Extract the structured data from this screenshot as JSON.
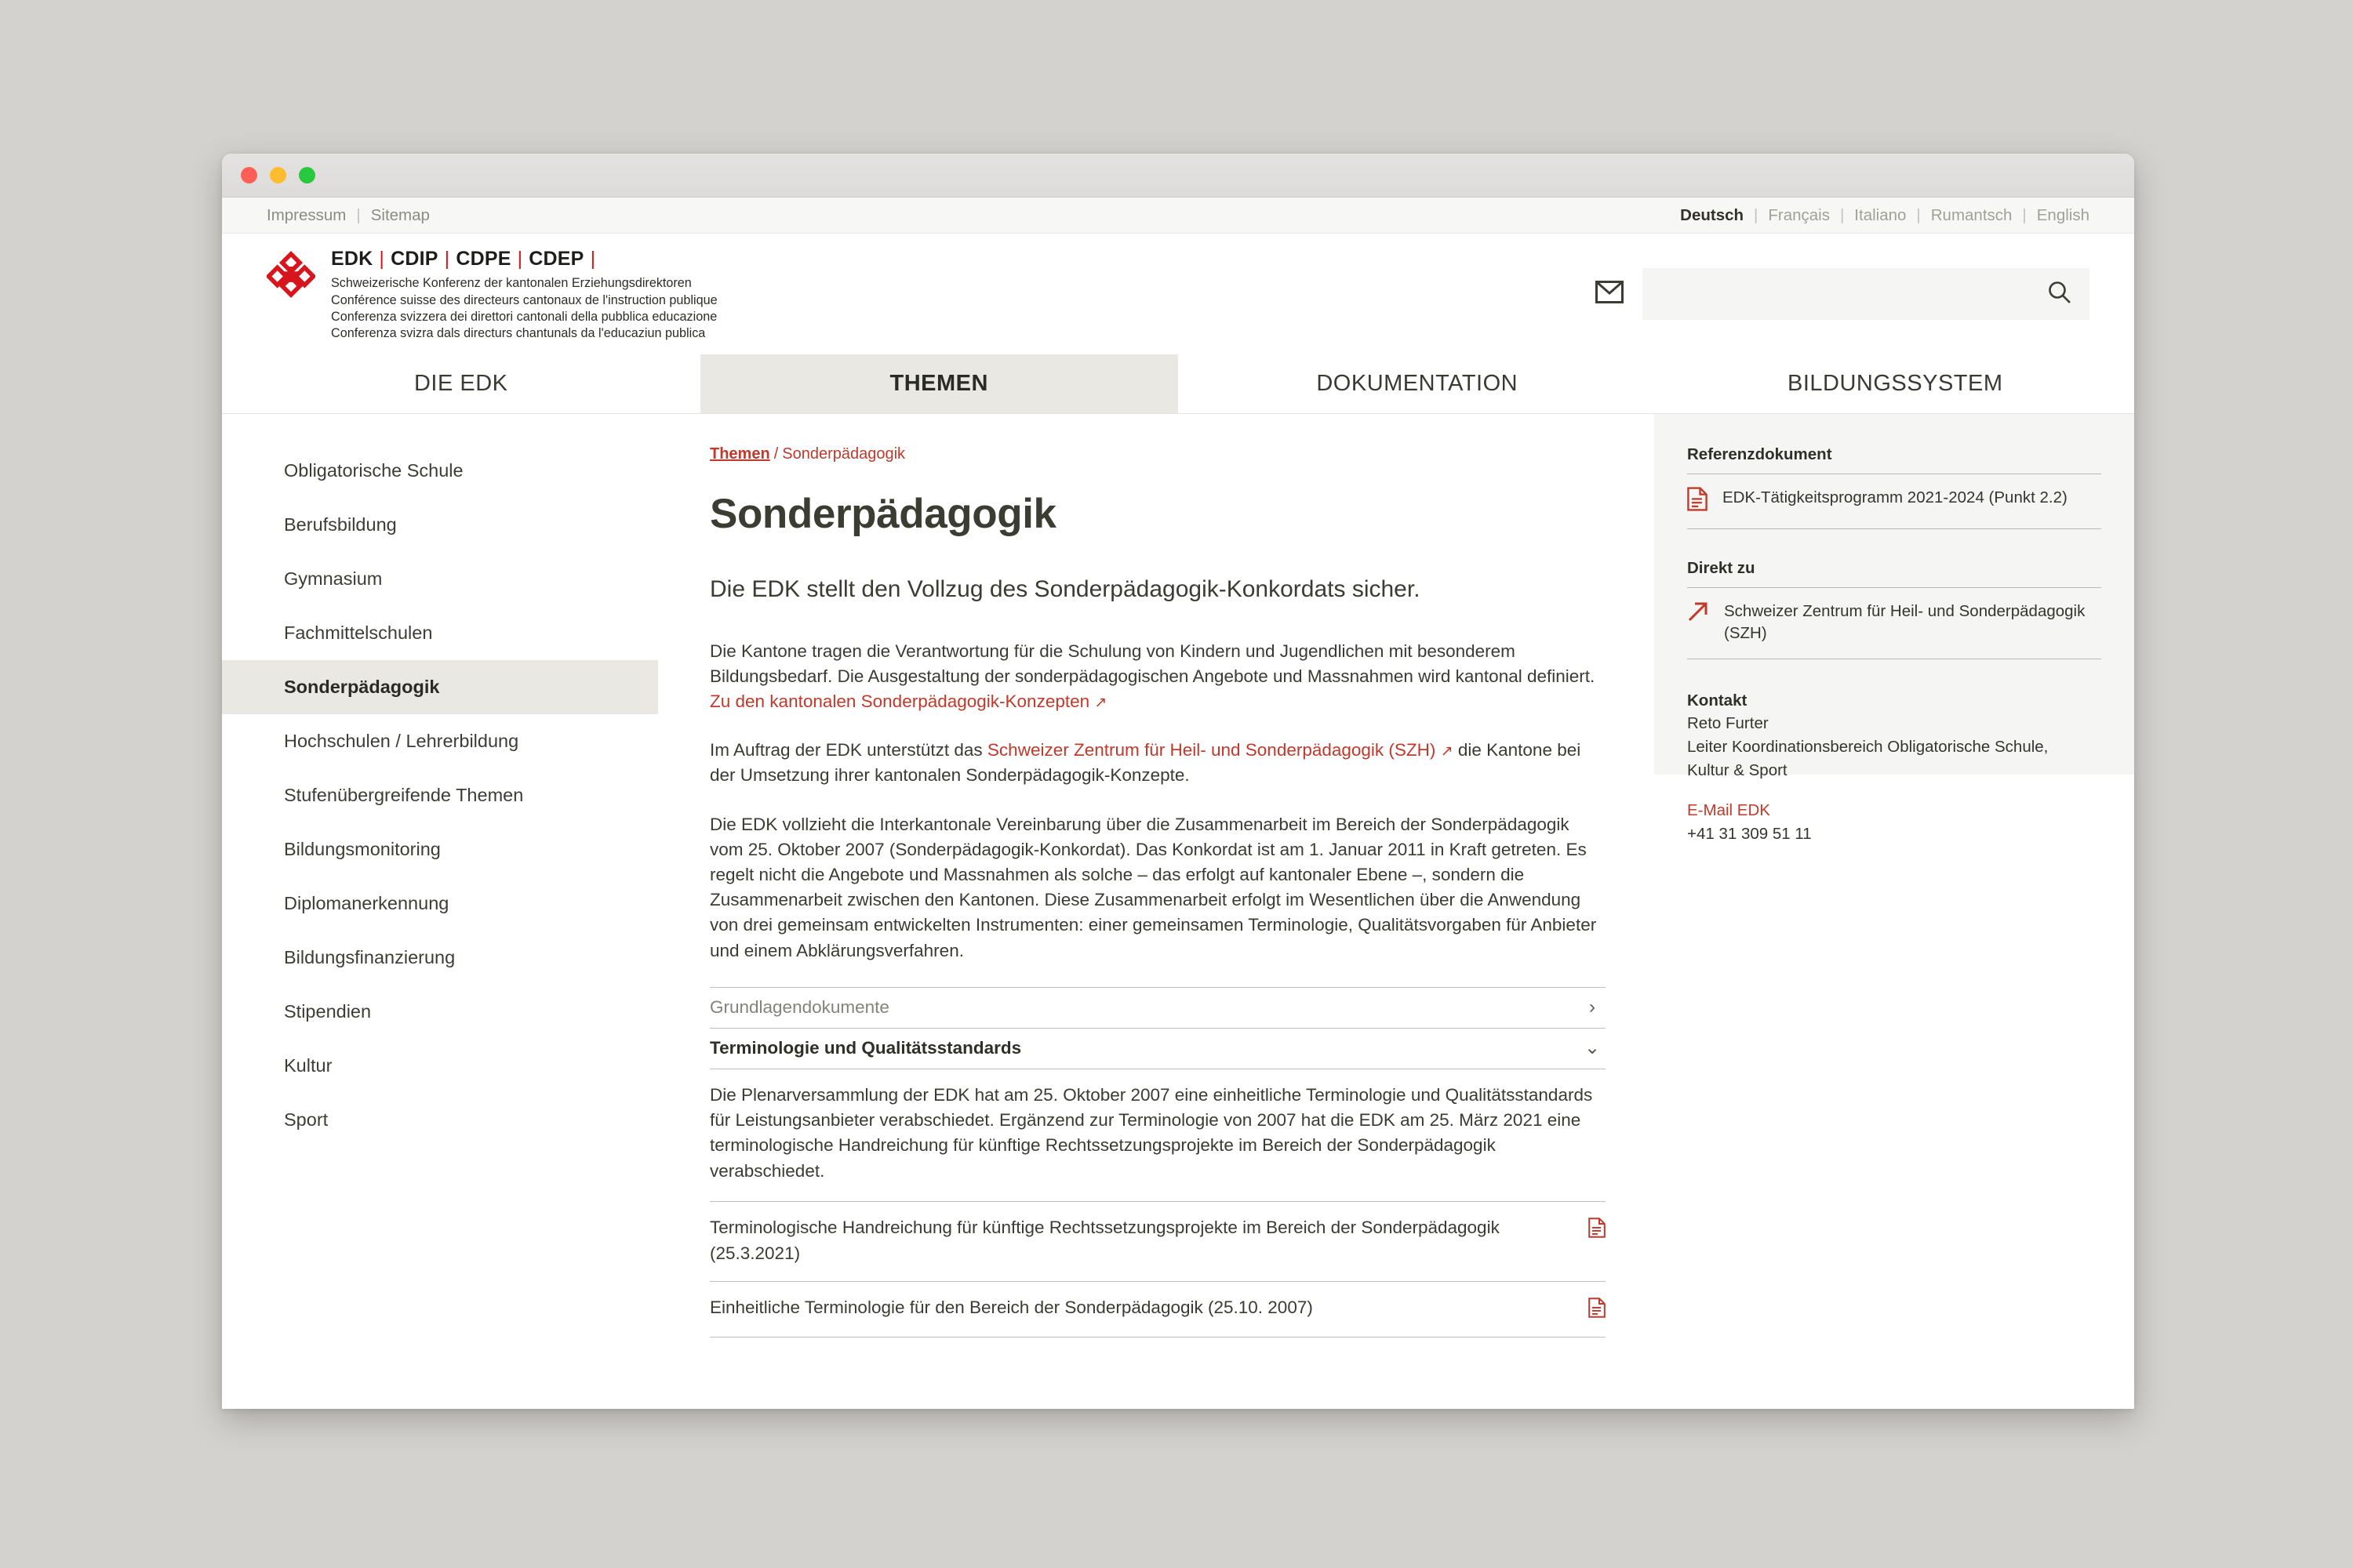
{
  "window": {
    "traffic_lights": [
      "close",
      "minimize",
      "zoom"
    ]
  },
  "metabar": {
    "impressum": "Impressum",
    "separator": "|",
    "sitemap": "Sitemap",
    "languages": [
      {
        "label": "Deutsch",
        "active": true
      },
      {
        "label": "Français",
        "active": false
      },
      {
        "label": "Italiano",
        "active": false
      },
      {
        "label": "Rumantsch",
        "active": false
      },
      {
        "label": "English",
        "active": false
      }
    ]
  },
  "header": {
    "logo_icon": "edk-rosette-logo",
    "acronyms": [
      "EDK",
      "CDIP",
      "CDPE",
      "CDEP"
    ],
    "acronym_separator": "|",
    "subtitles": [
      "Schweizerische Konferenz der kantonalen Erziehungsdirektoren",
      "Conférence suisse des directeurs cantonaux de l'instruction publique",
      "Conferenza svizzera dei direttori cantonali della pubblica educazione",
      "Conferenza svizra dals directurs chantunals da l'educaziun publica"
    ],
    "mail_icon": "envelope-icon",
    "search": {
      "value": "",
      "placeholder": "",
      "icon": "search-icon"
    }
  },
  "mainnav": {
    "tabs": [
      {
        "label": "DIE EDK",
        "active": false
      },
      {
        "label": "THEMEN",
        "active": true
      },
      {
        "label": "DOKUMENTATION",
        "active": false
      },
      {
        "label": "BILDUNGSSYSTEM",
        "active": false
      }
    ]
  },
  "sidebar": {
    "items": [
      {
        "label": "Obligatorische Schule",
        "active": false
      },
      {
        "label": "Berufsbildung",
        "active": false
      },
      {
        "label": "Gymnasium",
        "active": false
      },
      {
        "label": "Fachmittelschulen",
        "active": false
      },
      {
        "label": "Sonderpädagogik",
        "active": true
      },
      {
        "label": "Hochschulen / Lehrerbildung",
        "active": false
      },
      {
        "label": "Stufenübergreifende Themen",
        "active": false
      },
      {
        "label": "Bildungsmonitoring",
        "active": false
      },
      {
        "label": "Diplomanerkennung",
        "active": false
      },
      {
        "label": "Bildungsfinanzierung",
        "active": false
      },
      {
        "label": "Stipendien",
        "active": false
      },
      {
        "label": "Kultur",
        "active": false
      },
      {
        "label": "Sport",
        "active": false
      }
    ]
  },
  "main": {
    "breadcrumb": {
      "parent": "Themen",
      "separator": "/",
      "current": "Sonderpädagogik"
    },
    "title": "Sonderpädagogik",
    "lead": "Die EDK stellt den Vollzug des Sonderpädagogik-Konkordats sicher.",
    "paragraph1_before": "Die Kantone tragen die Verantwortung für die Schulung von Kindern und Jugendlichen mit besonderem Bildungsbedarf. Die Ausgestaltung der sonderpädagogischen Angebote und Massnahmen wird kantonal definiert. ",
    "paragraph1_link": "Zu den kantonalen Sonderpädagogik-Konzepten",
    "paragraph2_before": "Im Auftrag der EDK unterstützt das ",
    "paragraph2_link": "Schweizer Zentrum für Heil- und Sonderpädagogik (SZH)",
    "paragraph2_after": " die Kantone bei der Umsetzung ihrer kantonalen Sonderpädagogik-Konzepte.",
    "paragraph3": "Die EDK vollzieht die Interkantonale Vereinbarung über die Zusammenarbeit im Bereich der Sonderpädagogik vom 25. Oktober 2007 (Sonderpädagogik-Konkordat). Das Konkordat ist am 1. Januar 2011 in Kraft getreten. Es regelt nicht die Angebote und Massnahmen als solche – das erfolgt auf kantonaler Ebene –, sondern die Zusammenarbeit zwischen den Kantonen. Diese Zusammenarbeit erfolgt im Wesentlichen über die Anwendung von drei gemeinsam entwickelten Instrumenten: einer gemeinsamen Terminologie, Qualitätsvorgaben für Anbieter und einem Abklärungsverfahren.",
    "accordion": {
      "item1": {
        "label": "Grundlagendokumente",
        "expanded": false,
        "icon": "chevron-right-icon"
      },
      "item2": {
        "label": "Terminologie und Qualitätsstandards",
        "expanded": true,
        "icon": "chevron-down-icon"
      },
      "item2_body": "Die Plenarversammlung der EDK hat am 25. Oktober 2007 eine einheitliche Terminologie und Qualitätsstandards für Leistungsanbieter verabschiedet. Ergänzend zur Terminologie von 2007 hat die EDK am 25. März 2021 eine terminologische Handreichung für künftige Rechtssetzungsprojekte im Bereich der Sonderpädagogik verabschiedet.",
      "documents": [
        {
          "label": "Terminologische Handreichung für künftige Rechtssetzungsprojekte im Bereich der Sonderpädagogik (25.3.2021)",
          "icon": "pdf-document-icon"
        },
        {
          "label": "Einheitliche Terminologie für den Bereich der Sonderpädagogik (25.10. 2007)",
          "icon": "pdf-document-icon"
        }
      ]
    }
  },
  "rail": {
    "reference": {
      "heading": "Referenzdokument",
      "item": {
        "label": "EDK-Tätigkeitsprogramm 2021-2024 (Punkt 2.2)",
        "icon": "pdf-document-icon"
      }
    },
    "direct": {
      "heading": "Direkt zu",
      "item": {
        "label": "Schweizer Zentrum für Heil- und Sonderpädagogik (SZH)",
        "icon": "external-arrow-icon"
      }
    },
    "contact": {
      "heading": "Kontakt",
      "name": "Reto Furter",
      "role_line1": "Leiter Koordinationsbereich Obligatorische Schule,",
      "role_line2": "Kultur & Sport",
      "email_label": "E-Mail EDK",
      "phone": "+41 31 309 51 11"
    }
  },
  "colors": {
    "brand_red": "#d7151d",
    "link_red": "#c0392b",
    "text_dark": "#3b3b33",
    "active_bg": "#eae8e3",
    "rail_bg": "#f5f5f3"
  }
}
